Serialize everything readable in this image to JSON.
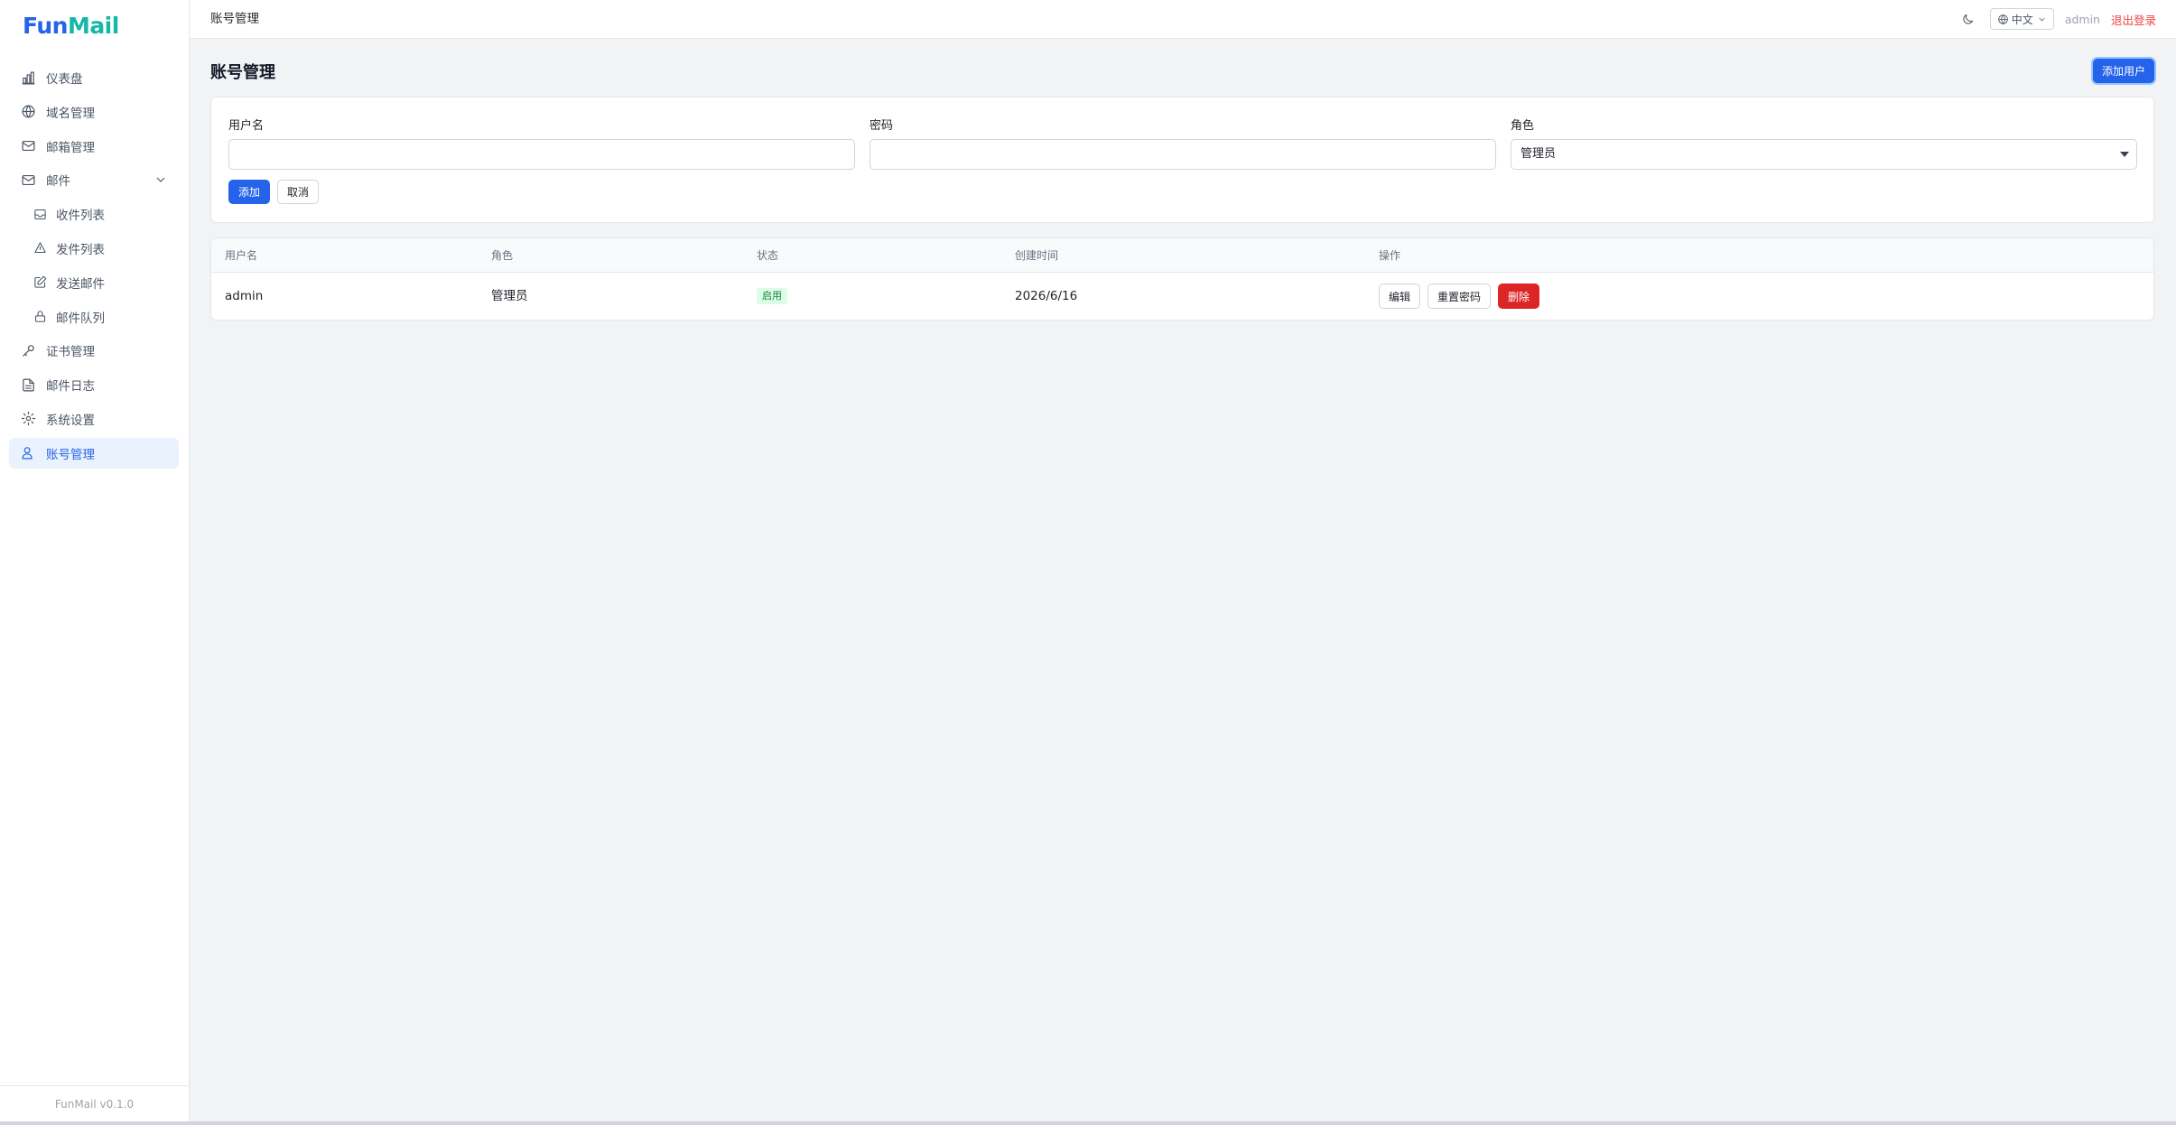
{
  "logo": {
    "part1": "Fun",
    "part2": "Mail"
  },
  "sidebar": {
    "items": [
      {
        "label": "仪表盘",
        "icon": "bar-chart-icon"
      },
      {
        "label": "域名管理",
        "icon": "globe-icon"
      },
      {
        "label": "邮箱管理",
        "icon": "mail-icon"
      },
      {
        "label": "邮件",
        "icon": "mail-icon"
      },
      {
        "label": "收件列表",
        "icon": "inbox-icon"
      },
      {
        "label": "发件列表",
        "icon": "send-icon"
      },
      {
        "label": "发送邮件",
        "icon": "edit-icon"
      },
      {
        "label": "邮件队列",
        "icon": "lock-icon"
      },
      {
        "label": "证书管理",
        "icon": "key-icon"
      },
      {
        "label": "邮件日志",
        "icon": "file-text-icon"
      },
      {
        "label": "系统设置",
        "icon": "gear-icon"
      },
      {
        "label": "账号管理",
        "icon": "users-icon"
      }
    ],
    "footer": "FunMail v0.1.0"
  },
  "header": {
    "breadcrumb": "账号管理",
    "language": "中文",
    "username": "admin",
    "logout": "退出登录"
  },
  "main": {
    "title": "账号管理",
    "add_user_button": "添加用户",
    "form": {
      "username_label": "用户名",
      "username_value": "",
      "password_label": "密码",
      "password_value": "",
      "role_label": "角色",
      "role_value": "管理员",
      "submit": "添加",
      "cancel": "取消"
    },
    "table": {
      "headers": [
        "用户名",
        "角色",
        "状态",
        "创建时间",
        "操作"
      ],
      "rows": [
        {
          "username": "admin",
          "role": "管理员",
          "status": "启用",
          "created": "2026/6/16",
          "actions": {
            "edit": "编辑",
            "reset": "重置密码",
            "delete": "删除"
          }
        }
      ]
    }
  },
  "colors": {
    "accent": "#2563eb",
    "danger": "#dc2626",
    "success_bg": "#dcfce7",
    "logout": "#ef4444"
  }
}
